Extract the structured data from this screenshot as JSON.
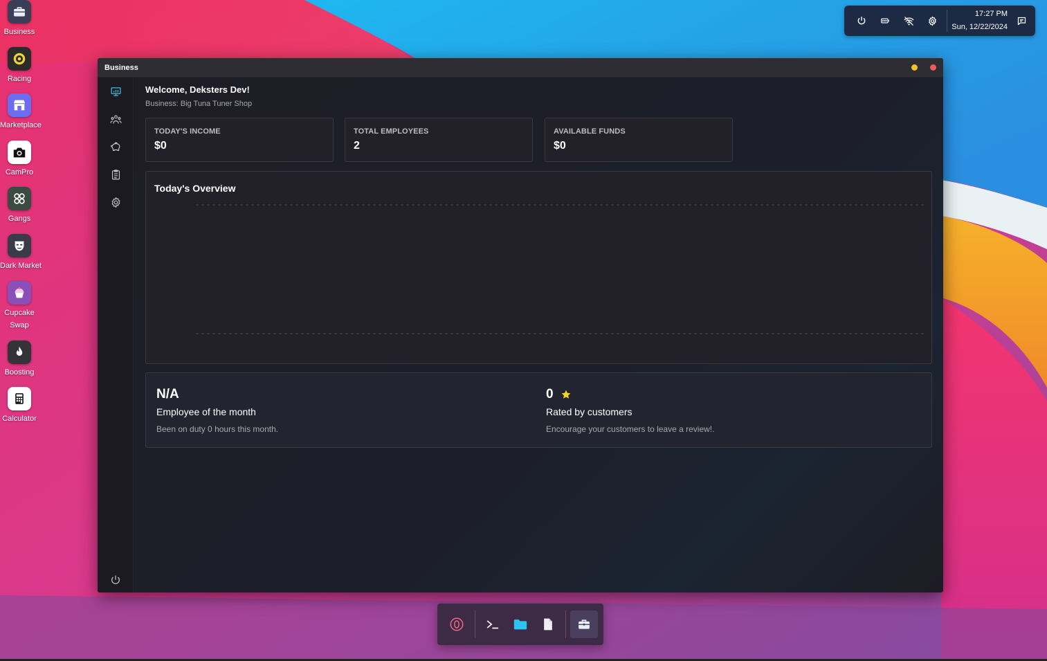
{
  "desktop": {
    "icons": [
      {
        "label": "Business",
        "icon": "briefcase-icon",
        "color": "#3a3f55"
      },
      {
        "label": "Racing",
        "icon": "racing-badge-icon",
        "color": "#2b2b2b"
      },
      {
        "label": "Marketplace",
        "icon": "store-icon",
        "color": "#6c6cf0"
      },
      {
        "label": "CamPro",
        "icon": "camera-icon",
        "color": "#ffffff"
      },
      {
        "label": "Gangs",
        "icon": "gangs-icon",
        "color": "#3b4a43"
      },
      {
        "label": "Dark Market",
        "icon": "mask-icon",
        "color": "#3a3a4a"
      },
      {
        "label": "Cupcake Swap",
        "icon": "cupcake-icon",
        "color": "#8a4fb8"
      },
      {
        "label": "Boosting",
        "icon": "flame-icon",
        "color": "#333338"
      },
      {
        "label": "Calculator",
        "icon": "calculator-icon",
        "color": "#ffffff"
      }
    ]
  },
  "tray": {
    "icons": [
      "power-icon",
      "battery-icon",
      "wifi-off-icon",
      "gear-icon"
    ],
    "time": "17:27 PM",
    "date": "Sun, 12/22/2024",
    "notification_icon": "message-icon"
  },
  "window": {
    "title": "Business",
    "minimize_color": "#f2c12e",
    "close_color": "#ef5b5b",
    "nav": [
      "dashboard-icon",
      "employees-icon",
      "piggy-bank-icon",
      "clipboard-icon",
      "settings-icon"
    ],
    "nav_bottom": "power-icon"
  },
  "dashboard": {
    "welcome": "Welcome, Deksters Dev!",
    "business_line": "Business: Big Tuna Tuner Shop",
    "stats": [
      {
        "label": "Today's Income",
        "value": "$0"
      },
      {
        "label": "Total Employees",
        "value": "2"
      },
      {
        "label": "Available Funds",
        "value": "$0"
      }
    ],
    "overview_title": "Today's Overview",
    "employee": {
      "value": "N/A",
      "title": "Employee of the month",
      "desc": "Been on duty 0 hours this month."
    },
    "rating": {
      "value": "0",
      "title": "Rated by customers",
      "desc": "Encourage your customers to leave a review!."
    }
  },
  "dock": {
    "icons": [
      "zero-circle-icon",
      "terminal-icon",
      "folder-icon",
      "file-icon",
      "briefcase-icon"
    ]
  }
}
